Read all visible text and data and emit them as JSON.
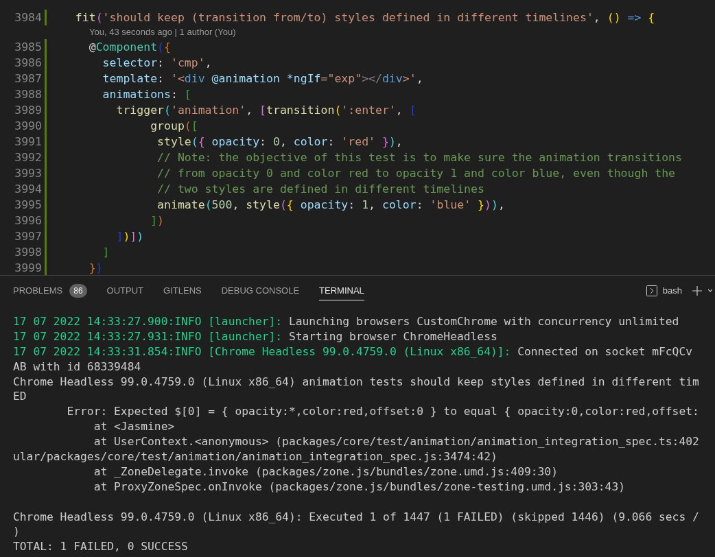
{
  "editor": {
    "lines": [
      {
        "number": "3984",
        "changed": true,
        "tokens": [
          {
            "t": "  fit",
            "kind": "fn"
          },
          {
            "t": "(",
            "kind": "purple"
          },
          {
            "t": "'should keep (transition from/to) styles defined in different timelines'",
            "kind": "str"
          },
          {
            "t": ",",
            "kind": "p"
          },
          {
            "t": " ()",
            "kind": "gold"
          },
          {
            "t": " =>",
            "kind": "kw"
          },
          {
            "t": " {",
            "kind": "gold"
          }
        ]
      },
      {
        "codelens": "You, 43 seconds ago | 1 author (You)"
      },
      {
        "number": "3985",
        "changed": true,
        "tokens": [
          {
            "t": "    @",
            "kind": "p"
          },
          {
            "t": "Component",
            "kind": "cls"
          },
          {
            "t": "(",
            "kind": "blue"
          },
          {
            "t": "{",
            "kind": "orange"
          }
        ]
      },
      {
        "number": "3986",
        "changed": true,
        "tokens": [
          {
            "t": "      selector",
            "kind": "prop"
          },
          {
            "t": ":",
            "kind": "p"
          },
          {
            "t": " 'cmp'",
            "kind": "str"
          },
          {
            "t": ",",
            "kind": "p"
          }
        ]
      },
      {
        "number": "3987",
        "changed": true,
        "tokens": [
          {
            "t": "      template",
            "kind": "prop"
          },
          {
            "t": ":",
            "kind": "p"
          },
          {
            "t": " '<",
            "kind": "str"
          },
          {
            "t": "div",
            "kind": "kw"
          },
          {
            "t": " @animation *ngIf",
            "kind": "prop"
          },
          {
            "t": "=\"exp\"",
            "kind": "str"
          },
          {
            "t": "></",
            "kind": "gray"
          },
          {
            "t": "div",
            "kind": "kw"
          },
          {
            "t": ">'",
            "kind": "str"
          },
          {
            "t": ",",
            "kind": "p"
          }
        ]
      },
      {
        "number": "3988",
        "changed": true,
        "tokens": [
          {
            "t": "      animations",
            "kind": "prop"
          },
          {
            "t": ":",
            "kind": "p"
          },
          {
            "t": " [",
            "kind": "green"
          }
        ]
      },
      {
        "number": "3989",
        "changed": true,
        "tokens": [
          {
            "t": "        trigger",
            "kind": "fn"
          },
          {
            "t": "(",
            "kind": "cyan"
          },
          {
            "t": "'animation'",
            "kind": "str"
          },
          {
            "t": ",",
            "kind": "p"
          },
          {
            "t": " [",
            "kind": "purple"
          },
          {
            "t": "transition",
            "kind": "fn"
          },
          {
            "t": "(",
            "kind": "gold"
          },
          {
            "t": "':enter'",
            "kind": "str"
          },
          {
            "t": ",",
            "kind": "p"
          },
          {
            "t": " [",
            "kind": "blue"
          }
        ]
      },
      {
        "number": "3990",
        "changed": true,
        "tokens": [
          {
            "t": "             group",
            "kind": "fn"
          },
          {
            "t": "(",
            "kind": "orange"
          },
          {
            "t": "[",
            "kind": "green"
          }
        ]
      },
      {
        "number": "3991",
        "changed": true,
        "tokens": [
          {
            "t": "              style",
            "kind": "fn"
          },
          {
            "t": "(",
            "kind": "cyan"
          },
          {
            "t": "{",
            "kind": "purple"
          },
          {
            "t": " opacity",
            "kind": "prop"
          },
          {
            "t": ":",
            "kind": "p"
          },
          {
            "t": " 0",
            "kind": "num"
          },
          {
            "t": ",",
            "kind": "p"
          },
          {
            "t": " color",
            "kind": "prop"
          },
          {
            "t": ":",
            "kind": "p"
          },
          {
            "t": " 'red'",
            "kind": "str"
          },
          {
            "t": " }",
            "kind": "purple"
          },
          {
            "t": ")",
            "kind": "cyan"
          },
          {
            "t": ",",
            "kind": "p"
          }
        ]
      },
      {
        "number": "3992",
        "changed": true,
        "tokens": [
          {
            "t": "              // Note: the objective of this test is to make sure the animation transitions",
            "kind": "comment"
          }
        ]
      },
      {
        "number": "3993",
        "changed": true,
        "tokens": [
          {
            "t": "              // from opacity 0 and color red to opacity 1 and color blue, even though the",
            "kind": "comment"
          }
        ]
      },
      {
        "number": "3994",
        "changed": true,
        "tokens": [
          {
            "t": "              // two styles are defined in different timelines",
            "kind": "comment"
          }
        ]
      },
      {
        "number": "3995",
        "changed": true,
        "tokens": [
          {
            "t": "              animate",
            "kind": "fn"
          },
          {
            "t": "(",
            "kind": "cyan"
          },
          {
            "t": "500",
            "kind": "num"
          },
          {
            "t": ",",
            "kind": "p"
          },
          {
            "t": " style",
            "kind": "fn"
          },
          {
            "t": "(",
            "kind": "purple"
          },
          {
            "t": "{",
            "kind": "gold"
          },
          {
            "t": " opacity",
            "kind": "prop"
          },
          {
            "t": ":",
            "kind": "p"
          },
          {
            "t": " 1",
            "kind": "num"
          },
          {
            "t": ",",
            "kind": "p"
          },
          {
            "t": " color",
            "kind": "prop"
          },
          {
            "t": ":",
            "kind": "p"
          },
          {
            "t": " 'blue'",
            "kind": "str"
          },
          {
            "t": " }",
            "kind": "gold"
          },
          {
            "t": ")",
            "kind": "purple"
          },
          {
            "t": ")",
            "kind": "cyan"
          },
          {
            "t": ",",
            "kind": "p"
          }
        ]
      },
      {
        "number": "3996",
        "changed": true,
        "tokens": [
          {
            "t": "             ]",
            "kind": "green"
          },
          {
            "t": ")",
            "kind": "orange"
          }
        ]
      },
      {
        "number": "3997",
        "changed": true,
        "tokens": [
          {
            "t": "        ]",
            "kind": "blue"
          },
          {
            "t": ")",
            "kind": "gold"
          },
          {
            "t": "]",
            "kind": "purple"
          },
          {
            "t": ")",
            "kind": "cyan"
          }
        ]
      },
      {
        "number": "3998",
        "changed": true,
        "tokens": [
          {
            "t": "      ]",
            "kind": "green"
          }
        ]
      },
      {
        "number": "3999",
        "changed": true,
        "tokens": [
          {
            "t": "    }",
            "kind": "orange"
          },
          {
            "t": ")",
            "kind": "blue"
          }
        ]
      }
    ]
  },
  "panel": {
    "tabs": [
      {
        "label": "PROBLEMS",
        "badge": "86",
        "selected": false
      },
      {
        "label": "OUTPUT",
        "selected": false
      },
      {
        "label": "GITLENS",
        "selected": false
      },
      {
        "label": "DEBUG CONSOLE",
        "selected": false
      },
      {
        "label": "TERMINAL",
        "selected": true
      }
    ],
    "shell": "bash",
    "terminal": [
      {
        "kind": "text",
        "segments": [
          {
            "t": "17 07 2022 14:33:27.900:INFO [launcher]: ",
            "kind": "info"
          },
          {
            "t": "Launching browsers CustomChrome with concurrency unlimited",
            "kind": "plain"
          }
        ]
      },
      {
        "kind": "text",
        "segments": [
          {
            "t": "17 07 2022 14:33:27.931:INFO [launcher]: ",
            "kind": "info"
          },
          {
            "t": "Starting browser ChromeHeadless",
            "kind": "plain"
          }
        ]
      },
      {
        "kind": "text",
        "segments": [
          {
            "t": "17 07 2022 14:33:31.854:INFO [Chrome Headless 99.0.4759.0 (Linux x86_64)]: ",
            "kind": "info"
          },
          {
            "t": "Connected on socket mFcQCv",
            "kind": "plain"
          }
        ]
      },
      {
        "kind": "text",
        "segments": [
          {
            "t": "AB with id 68339484",
            "kind": "plain"
          }
        ]
      },
      {
        "kind": "text",
        "segments": [
          {
            "t": "Chrome Headless 99.0.4759.0 (Linux x86_64) animation tests should keep styles defined in different tim",
            "kind": "plain"
          }
        ]
      },
      {
        "kind": "text",
        "segments": [
          {
            "t": "ED",
            "kind": "plain"
          }
        ]
      },
      {
        "kind": "text",
        "segments": [
          {
            "t": "        Error: Expected $[0] = { opacity:*,color:red,offset:0 } to equal { opacity:0,color:red,offset:",
            "kind": "plain"
          }
        ]
      },
      {
        "kind": "text",
        "segments": [
          {
            "t": "            at <Jasmine>",
            "kind": "plain"
          }
        ]
      },
      {
        "kind": "text",
        "segments": [
          {
            "t": "            at UserContext.<anonymous> (packages/core/test/animation/animation_integration_spec.ts:402",
            "kind": "plain"
          }
        ]
      },
      {
        "kind": "text",
        "segments": [
          {
            "t": "ular/packages/core/test/animation/animation_integration_spec.js:3474:42)",
            "kind": "plain"
          }
        ]
      },
      {
        "kind": "text",
        "segments": [
          {
            "t": "            at _ZoneDelegate.invoke (packages/zone.js/bundles/zone.umd.js:409:30)",
            "kind": "plain"
          }
        ]
      },
      {
        "kind": "text",
        "segments": [
          {
            "t": "            at ProxyZoneSpec.onInvoke (packages/zone.js/bundles/zone-testing.umd.js:303:43)",
            "kind": "plain"
          }
        ]
      },
      {
        "kind": "blank"
      },
      {
        "kind": "text",
        "segments": [
          {
            "t": "Chrome Headless 99.0.4759.0 (Linux x86_64): Executed 1 of 1447 (1 FAILED) (skipped 1446) (9.066 secs /",
            "kind": "plain"
          }
        ]
      },
      {
        "kind": "text",
        "segments": [
          {
            "t": ")",
            "kind": "plain"
          }
        ]
      },
      {
        "kind": "text",
        "segments": [
          {
            "t": "TOTAL: 1 FAILED, 0 SUCCESS",
            "kind": "plain"
          }
        ]
      }
    ]
  }
}
